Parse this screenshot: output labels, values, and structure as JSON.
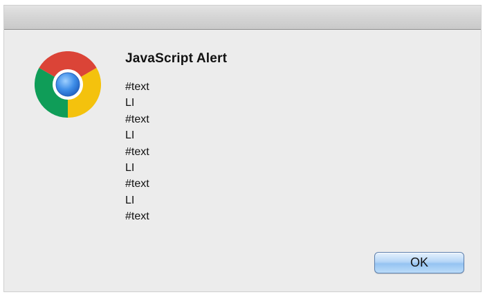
{
  "dialog": {
    "icon": "chrome-logo-icon",
    "title": "JavaScript Alert",
    "lines": [
      "#text",
      "LI",
      "#text",
      "LI",
      "#text",
      "LI",
      "#text",
      "LI",
      "#text"
    ],
    "ok_label": "OK"
  },
  "colors": {
    "dialog_bg": "#ececec",
    "button_blue": "#b6d6f7",
    "chrome_red": "#db4437",
    "chrome_yellow": "#f4c20d",
    "chrome_green": "#0f9d58",
    "chrome_blue": "#4285f4"
  }
}
